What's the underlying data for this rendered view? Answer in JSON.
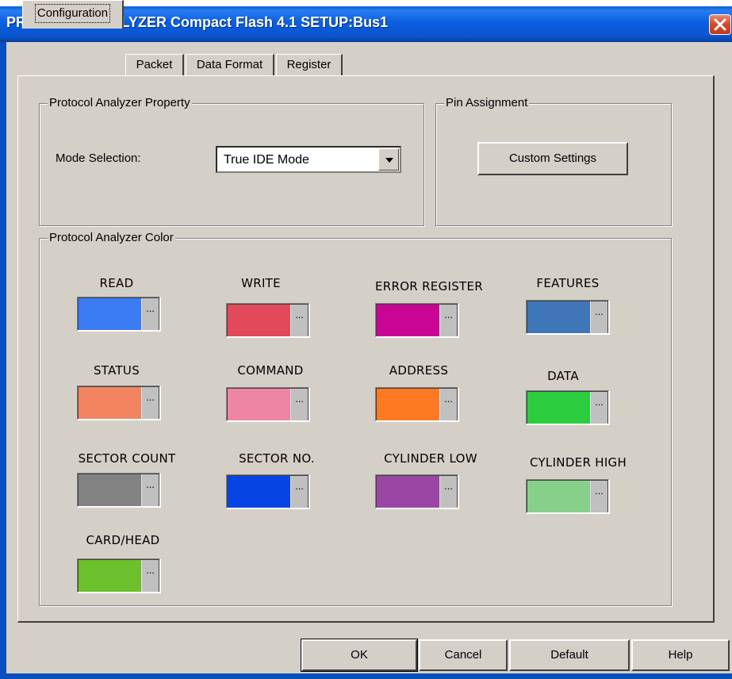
{
  "window": {
    "title": "PROTOCOL ANALYZER Compact Flash 4.1 SETUP:Bus1",
    "close_icon": "close-icon"
  },
  "tabs": [
    {
      "label": "Configuration",
      "active": true
    },
    {
      "label": "Packet",
      "active": false
    },
    {
      "label": "Data Format",
      "active": false
    },
    {
      "label": "Register",
      "active": false
    }
  ],
  "property_group": {
    "legend": "Protocol Analyzer Property",
    "mode_label": "Mode Selection:",
    "mode_value": "True IDE Mode"
  },
  "pin_group": {
    "legend": "Pin Assignment",
    "custom_button": "Custom Settings"
  },
  "color_group": {
    "legend": "Protocol Analyzer Color",
    "button_glyph": "...",
    "items": [
      {
        "label": "READ",
        "color": "#3b7cf5"
      },
      {
        "label": "WRITE",
        "color": "#e2495b"
      },
      {
        "label": "ERROR REGISTER",
        "color": "#c80594"
      },
      {
        "label": "FEATURES",
        "color": "#3e76b7"
      },
      {
        "label": "STATUS",
        "color": "#f28560"
      },
      {
        "label": "COMMAND",
        "color": "#ee86a3"
      },
      {
        "label": "ADDRESS",
        "color": "#fd7a22"
      },
      {
        "label": "DATA",
        "color": "#2bcd3f"
      },
      {
        "label": "SECTOR COUNT",
        "color": "#828282"
      },
      {
        "label": "SECTOR NO.",
        "color": "#0744e4"
      },
      {
        "label": "CYLINDER LOW",
        "color": "#9b46a4"
      },
      {
        "label": "CYLINDER HIGH",
        "color": "#86d08a"
      },
      {
        "label": "CARD/HEAD",
        "color": "#6cc02b"
      }
    ]
  },
  "footer": {
    "ok": "OK",
    "cancel": "Cancel",
    "default": "Default",
    "help": "Help"
  }
}
